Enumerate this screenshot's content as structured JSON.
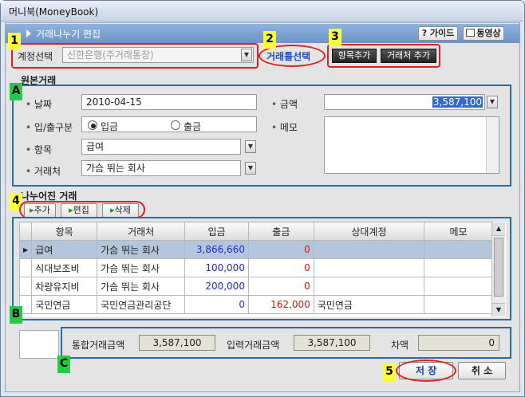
{
  "window": {
    "title": "머니북(MoneyBook)"
  },
  "header": {
    "title": "거래나누기 편집",
    "guide_label": "? 가이드",
    "video_label": "동영상"
  },
  "toolbar": {
    "account_label": "계정선택",
    "account_value": "신한은행(주거래통장)",
    "template_label": "거래틀선택",
    "add_item_label": "항목추가",
    "add_vendor_label": "거래처 추가"
  },
  "original": {
    "section_title": "원본거래",
    "date_label": "날짜",
    "date_value": "2010-04-15",
    "amount_label": "금액",
    "amount_value": "3,587,100",
    "inout_label": "입/출구분",
    "in_label": "입금",
    "out_label": "출금",
    "memo_label": "메모",
    "item_label": "항목",
    "item_value": "급여",
    "vendor_label": "거래처",
    "vendor_value": "가슴 뛰는 회사"
  },
  "split": {
    "section_title": "나누어진 거래",
    "add_label": "추가",
    "edit_label": "편집",
    "delete_label": "삭제",
    "columns": [
      "항목",
      "거래처",
      "입금",
      "출금",
      "상대계정",
      "메모"
    ],
    "rows": [
      {
        "item": "급여",
        "vendor": "가슴 뛰는 회사",
        "in": "3,866,660",
        "out": "0",
        "counter": "",
        "memo": ""
      },
      {
        "item": "식대보조비",
        "vendor": "가슴 뛰는 회사",
        "in": "100,000",
        "out": "0",
        "counter": "",
        "memo": ""
      },
      {
        "item": "차량유지비",
        "vendor": "가슴 뛰는 회사",
        "in": "200,000",
        "out": "0",
        "counter": "",
        "memo": ""
      },
      {
        "item": "국민연금",
        "vendor": "국민연금관리공단",
        "in": "0",
        "out": "162,000",
        "counter": "국민연금",
        "memo": ""
      }
    ]
  },
  "summary": {
    "total_label": "통합거래금액",
    "total_value": "3,587,100",
    "input_label": "입력거래금액",
    "input_value": "3,587,100",
    "diff_label": "차액",
    "diff_value": "0"
  },
  "footer": {
    "save_label": "저 장",
    "cancel_label": "취 소"
  },
  "tags": {
    "t1": "1",
    "t2": "2",
    "t3": "3",
    "t4": "4",
    "t5": "5",
    "tA": "A",
    "tB": "B",
    "tC": "C"
  },
  "icons": {
    "combo": "chevron-down-icon",
    "radio": "radio-icon"
  }
}
